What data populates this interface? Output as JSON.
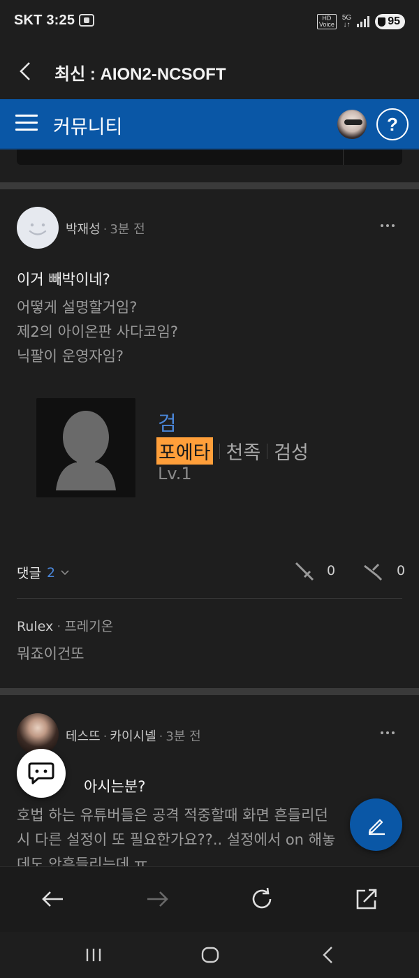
{
  "status": {
    "carrier_time": "SKT 3:25",
    "hd_label": "HD\nVoice",
    "network_label": "5G",
    "battery_percent": "95"
  },
  "titlebar": {
    "title": "최신 : AION2-NCSOFT"
  },
  "community_bar": {
    "title": "커뮤니티",
    "help_label": "?"
  },
  "posts": [
    {
      "author": "박재성",
      "time": "3분 전",
      "title": "이거 빼박이네?",
      "body": "어떻게 설명할거임?\n제2의 아이온판 사다코임?\n닉팔이 운영자임?",
      "character": {
        "class_name": "검",
        "name": "포에타",
        "race": "천족",
        "server": "검성",
        "level": "Lv.1"
      },
      "comments_label": "댓글",
      "comments_count": "2",
      "like_count": "0",
      "dislike_count": "0",
      "top_comment": {
        "author": "Rulex",
        "server": "프레기온",
        "text": "뭐죠이건또"
      }
    },
    {
      "author": "테스뜨",
      "server": "카이시넬",
      "time": "3분 전",
      "title_visible": "아시는분?",
      "body": "호법 하는 유튜버들은 공격 적중할때 화면 흔들리던\n시 다른 설정이 또 필요한가요??.. 설정에서 on 해놓\n데도 안흔들리는데 ㅠ"
    }
  ]
}
